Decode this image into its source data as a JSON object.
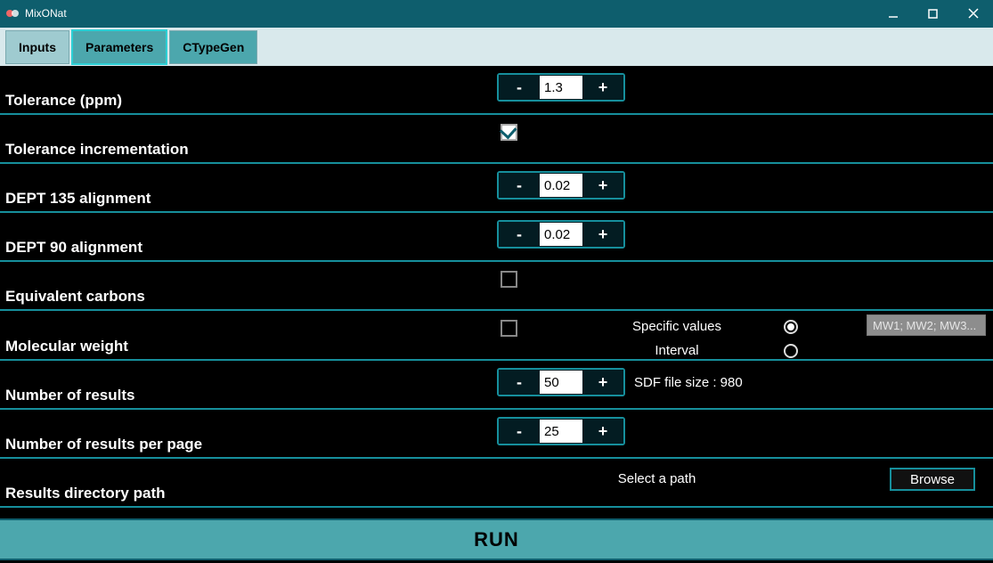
{
  "window": {
    "title": "MixONat"
  },
  "tabs": {
    "inputs": "Inputs",
    "parameters": "Parameters",
    "ctypegen": "CTypeGen"
  },
  "rows": {
    "tolerance_ppm": {
      "label": "Tolerance (ppm)",
      "value": "1.3"
    },
    "tolerance_inc": {
      "label": "Tolerance incrementation",
      "checked": true
    },
    "dept135": {
      "label": "DEPT 135 alignment",
      "value": "0.02"
    },
    "dept90": {
      "label": "DEPT 90 alignment",
      "value": "0.02"
    },
    "equiv_carbons": {
      "label": "Equivalent carbons",
      "checked": false
    },
    "mol_weight": {
      "label": "Molecular weight",
      "checked": false,
      "option_specific": "Specific values",
      "option_interval": "Interval",
      "selected": "specific",
      "placeholder": "MW1; MW2; MW3..."
    },
    "num_results": {
      "label": "Number of results",
      "value": "50",
      "note": "SDF file size : 980"
    },
    "num_per_page": {
      "label": "Number of results per page",
      "value": "25"
    },
    "results_path": {
      "label": "Results directory path",
      "path_text": "Select a path",
      "browse": "Browse"
    }
  },
  "run": "RUN",
  "glyphs": {
    "minus": "-",
    "plus": "+"
  }
}
